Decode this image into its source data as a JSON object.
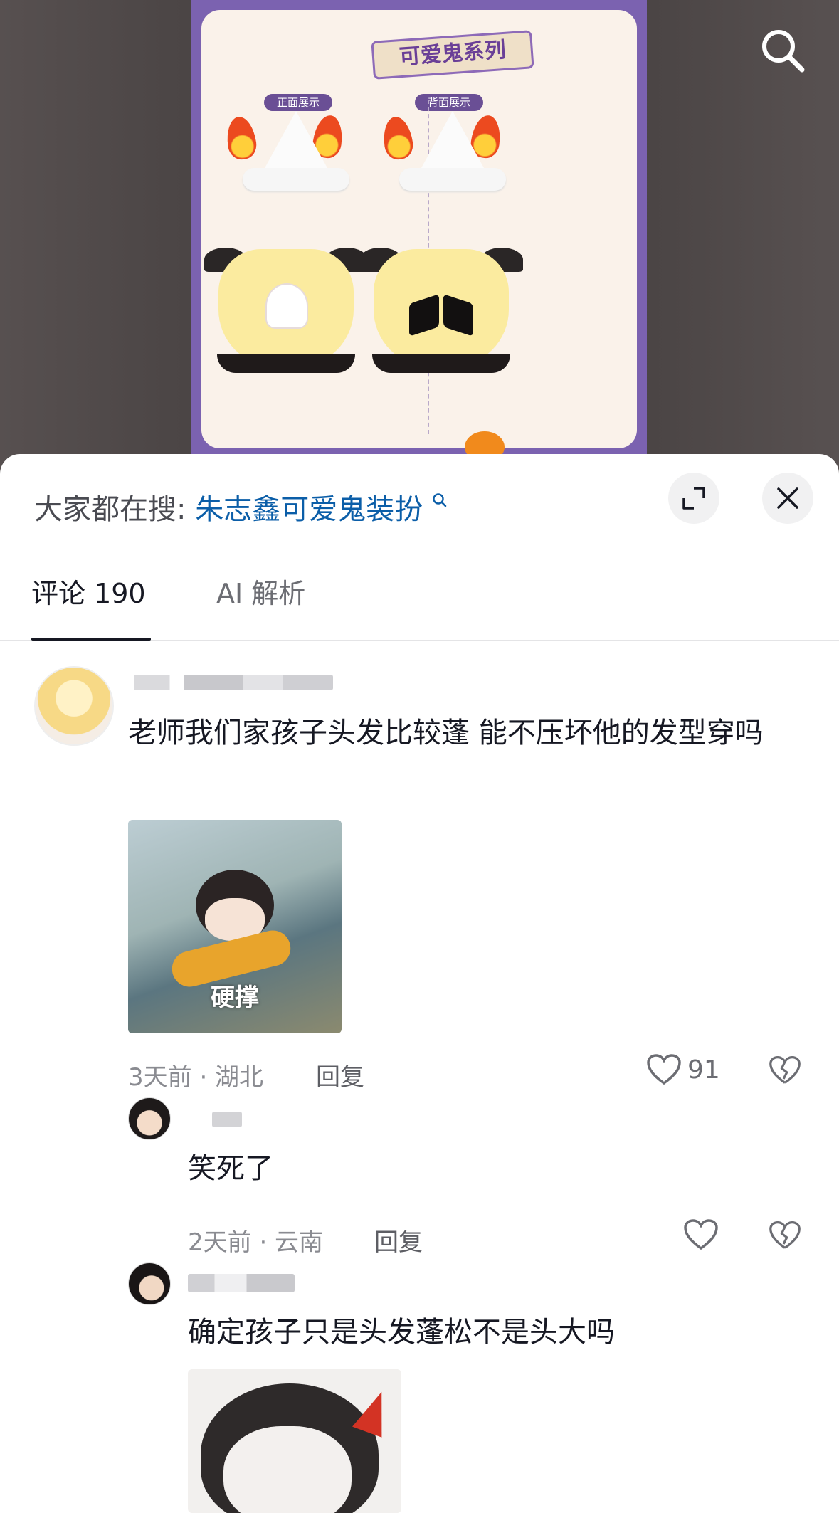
{
  "poster": {
    "title": "可爱鬼系列",
    "tag_front": "正面展示",
    "tag_back": "背面展示"
  },
  "top_bar": {
    "search_icon": "search-icon"
  },
  "panel": {
    "hot_search_label": "大家都在搜:",
    "hot_search_query": "朱志鑫可爱鬼装扮",
    "expand_icon": "expand-icon",
    "close_icon": "close-icon"
  },
  "tabs": [
    {
      "label": "评论 190",
      "active": true
    },
    {
      "label": "AI 解析",
      "active": false
    }
  ],
  "comments": [
    {
      "text": "老师我们家孩子头发比较蓬 能不压坏他的发型穿吗",
      "sticker_caption": "硬撑",
      "time_location": "3天前 · 湖北",
      "reply_label": "回复",
      "likes": "91",
      "replies": [
        {
          "text": "笑死了",
          "time_location": "2天前 · 云南",
          "reply_label": "回复"
        },
        {
          "text": "确定孩子只是头发蓬松不是头大吗"
        }
      ]
    }
  ],
  "colors": {
    "link_blue": "#0b5ea8",
    "text_primary": "#161823",
    "text_secondary": "#8a8b91",
    "poster_purple": "#7b62b0"
  }
}
